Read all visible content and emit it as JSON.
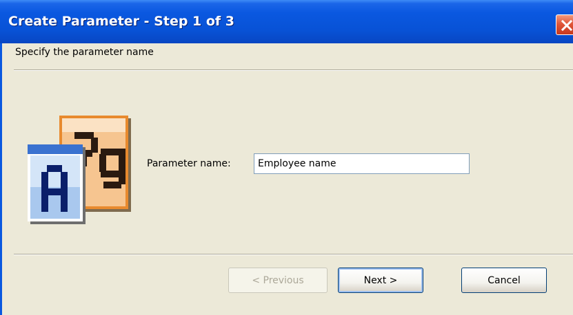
{
  "window": {
    "title": "Create Parameter - Step 1 of 3"
  },
  "header": {
    "subtitle": "Specify the parameter name"
  },
  "form": {
    "param_label": "Parameter name:",
    "param_value": "Employee name",
    "icon": "parameter-text-icon"
  },
  "buttons": {
    "previous": "< Previous",
    "next": "Next >",
    "cancel": "Cancel"
  },
  "colors": {
    "titlebar": "#0A58E0",
    "dialog_bg": "#ECE9D8",
    "close": "#E0573A"
  }
}
